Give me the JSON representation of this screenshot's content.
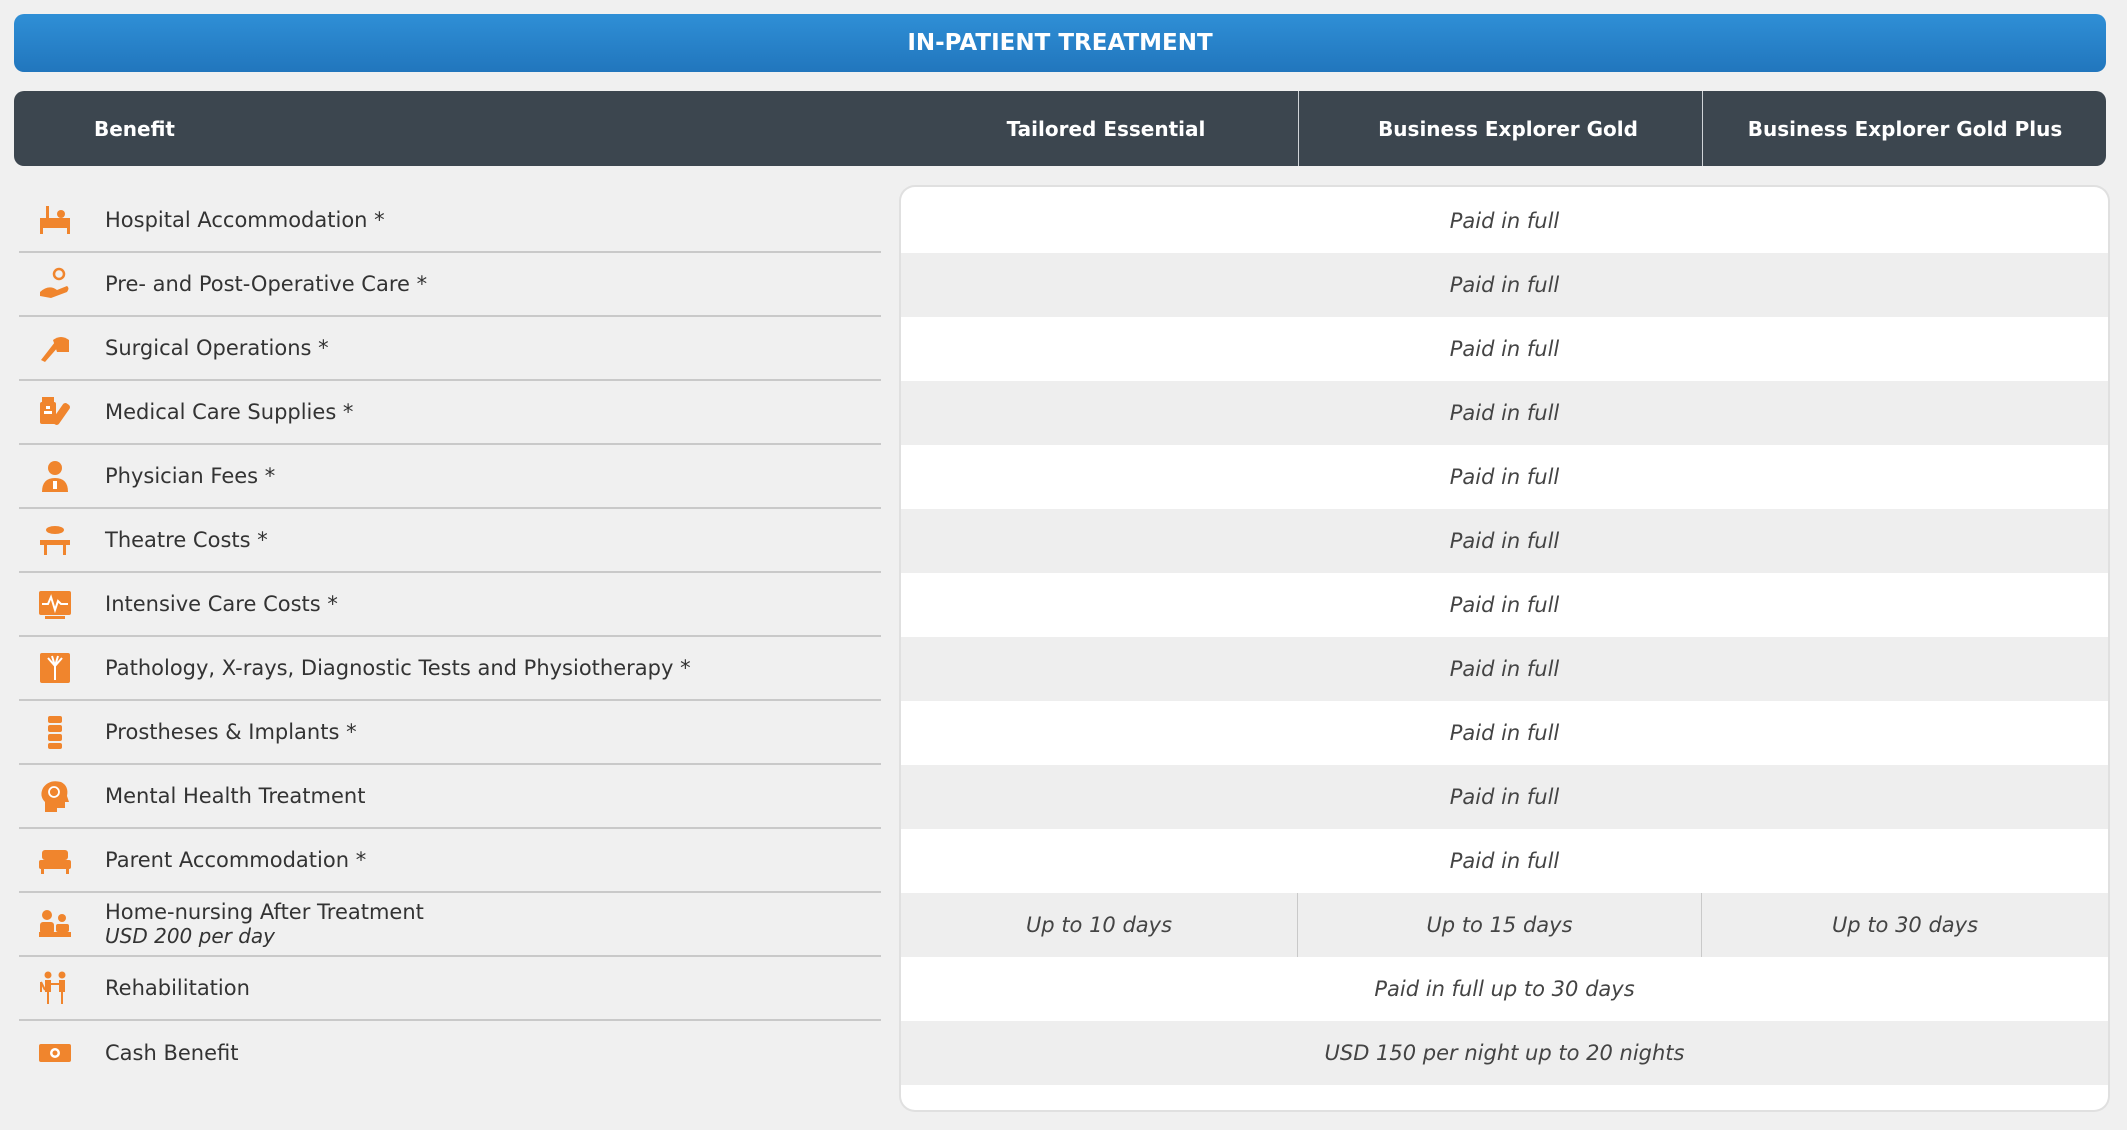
{
  "title": "IN-PATIENT TREATMENT",
  "header": {
    "benefit": "Benefit",
    "plans": [
      "Tailored Essential",
      "Business Explorer Gold",
      "Business Explorer Gold Plus"
    ]
  },
  "rows": [
    {
      "name": "Hospital Accommodation *",
      "icon": "hospital-bed-icon",
      "value": "Paid in full"
    },
    {
      "name": "Pre- and Post-Operative Care *",
      "icon": "hand-care-icon",
      "value": "Paid in full"
    },
    {
      "name": "Surgical Operations *",
      "icon": "scalpel-hand-icon",
      "value": "Paid in full"
    },
    {
      "name": "Medical Care Supplies *",
      "icon": "medicine-bandage-icon",
      "value": "Paid in full"
    },
    {
      "name": "Physician Fees *",
      "icon": "doctor-icon",
      "value": "Paid in full"
    },
    {
      "name": "Theatre Costs *",
      "icon": "operating-table-icon",
      "value": "Paid in full"
    },
    {
      "name": "Intensive Care Costs *",
      "icon": "heart-monitor-icon",
      "value": "Paid in full"
    },
    {
      "name": "Pathology, X-rays, Diagnostic Tests and Physiotherapy *",
      "icon": "xray-icon",
      "value": "Paid in full"
    },
    {
      "name": "Prostheses & Implants *",
      "icon": "spine-icon",
      "value": "Paid in full"
    },
    {
      "name": "Mental Health Treatment",
      "icon": "head-brain-icon",
      "value": "Paid in full"
    },
    {
      "name": "Parent Accommodation *",
      "icon": "bed-icon",
      "value": "Paid in full"
    },
    {
      "name": "Home-nursing After Treatment",
      "sub": "USD 200 per day",
      "icon": "home-nursing-icon",
      "values": [
        "Up to 10 days",
        "Up to 15  days",
        "Up to 30  days"
      ]
    },
    {
      "name": "Rehabilitation",
      "icon": "walking-assist-icon",
      "value": "Paid in full up to 30 days"
    },
    {
      "name": "Cash Benefit",
      "icon": "cash-icon",
      "value": "USD 150 per night up to 20 nights"
    }
  ],
  "colors": {
    "accent": "#2f86cf",
    "header": "#3c464f",
    "icon": "#f0852d"
  }
}
